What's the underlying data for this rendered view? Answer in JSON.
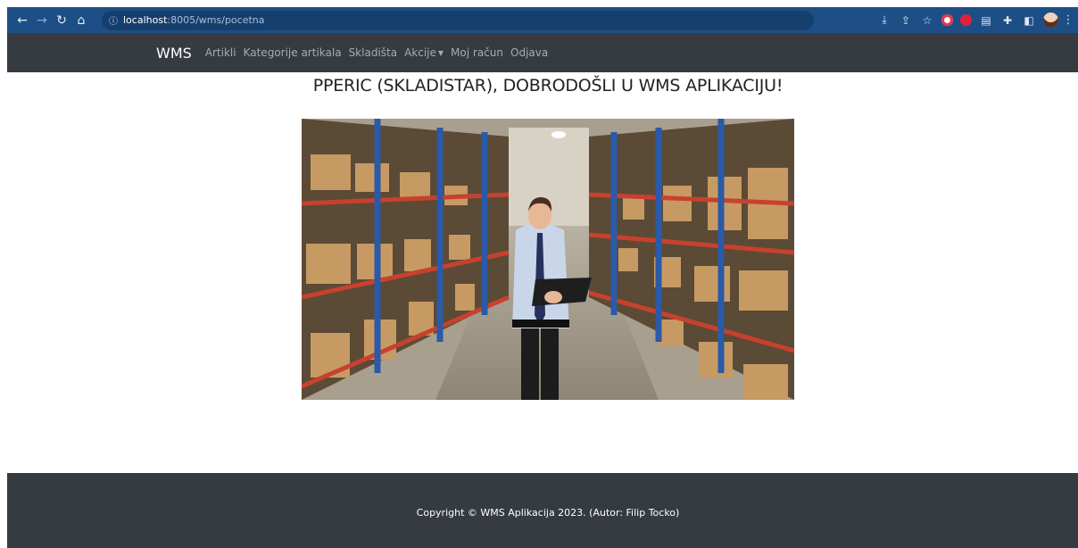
{
  "browser": {
    "url_host": "localhost",
    "url_rest": ":8005/wms/pocetna"
  },
  "navbar": {
    "brand": "WMS",
    "links": [
      "Artikli",
      "Kategorije artikala",
      "Skladišta",
      "Akcije",
      "Moj račun",
      "Odjava"
    ]
  },
  "main": {
    "welcome": "PPERIC (SKLADISTAR), DOBRODOŠLI U WMS APLIKACIJU!"
  },
  "footer": {
    "copyright": "Copyright © WMS Aplikacija 2023. (Autor: Filip Tocko)"
  },
  "colors": {
    "chrome_bar": "#1d4f86",
    "navbar": "#353b41",
    "footer": "#353b41",
    "nav_link": "#a6acb2"
  }
}
